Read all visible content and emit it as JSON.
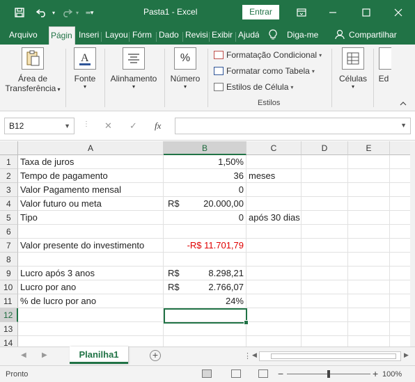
{
  "window": {
    "title": "Pasta1  -  Excel",
    "signin_label": "Entrar"
  },
  "tabs": [
    "Arquivo",
    "Págin",
    "Inseri",
    "Layou",
    "Fórm",
    "Dado",
    "Revisi",
    "Exibir",
    "Ajudá"
  ],
  "tell_me": "Diga-me",
  "share": "Compartilhar",
  "ribbon": {
    "clipboard": "Área de Transferência",
    "clipboard_line1": "Área de",
    "clipboard_line2": "Transferência",
    "font": "Fonte",
    "alignment": "Alinhamento",
    "number": "Número",
    "cond_format": "Formatação Condicional",
    "format_table": "Formatar como Tabela",
    "cell_styles": "Estilos de Célula",
    "styles_group": "Estilos",
    "cells": "Células",
    "edit": "Ed"
  },
  "formula_bar": {
    "name_box": "B12",
    "fx": "fx",
    "content": ""
  },
  "columns": [
    "A",
    "B",
    "C",
    "D",
    "E"
  ],
  "rows": [
    "1",
    "2",
    "3",
    "4",
    "5",
    "6",
    "7",
    "8",
    "9",
    "10",
    "11",
    "12",
    "13",
    "14"
  ],
  "cells": {
    "A1": "Taxa de juros",
    "B1": "1,50%",
    "A2": "Tempo de pagamento",
    "B2": "36",
    "C2": "meses",
    "A3": "Valor Pagamento mensal",
    "B3": "0",
    "A4": "Valor futuro ou meta",
    "B4_cur": "R$",
    "B4": "20.000,00",
    "A5": "Tipo",
    "B5": "0",
    "C5": "após 30 dias",
    "A7": "Valor presente do investimento",
    "B7": "-R$ 11.701,79",
    "A9": "Lucro após 3 anos",
    "B9_cur": "R$",
    "B9": "8.298,21",
    "A10": "Lucro por ano",
    "B10_cur": "R$",
    "B10": "2.766,07",
    "A11": "% de lucro por ano",
    "B11": "24%"
  },
  "sheet_tab": "Planilha1",
  "add_sheet": "+",
  "status": {
    "ready": "Pronto",
    "zoom": "100%"
  },
  "colors": {
    "accent": "#217346",
    "negative": "#e00000"
  }
}
